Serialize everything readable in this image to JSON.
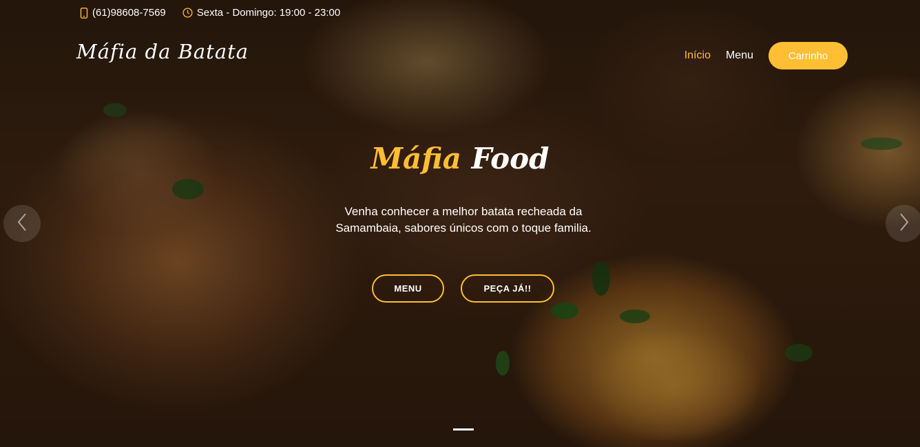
{
  "topbar": {
    "phone": "(61)98608-7569",
    "hours": "Sexta - Domingo: 19:00 - 23:00",
    "phone_icon": "phone-icon",
    "clock_icon": "clock-icon"
  },
  "header": {
    "brand": "Máfia da Batata",
    "nav": {
      "home": "Início",
      "menu": "Menu",
      "cart": "Carrinho"
    }
  },
  "hero": {
    "title_part1": "Máfia",
    "title_part2": "Food",
    "description": "Venha conhecer a melhor batata recheada da Samambaia, sabores únicos com o toque familia.",
    "btn_menu": "MENU",
    "btn_order": "PEÇA JÁ!!"
  },
  "carousel": {
    "prev_icon": "chevron-left-icon",
    "next_icon": "chevron-right-icon"
  },
  "colors": {
    "accent": "#ffbe33",
    "text": "#ffffff"
  }
}
